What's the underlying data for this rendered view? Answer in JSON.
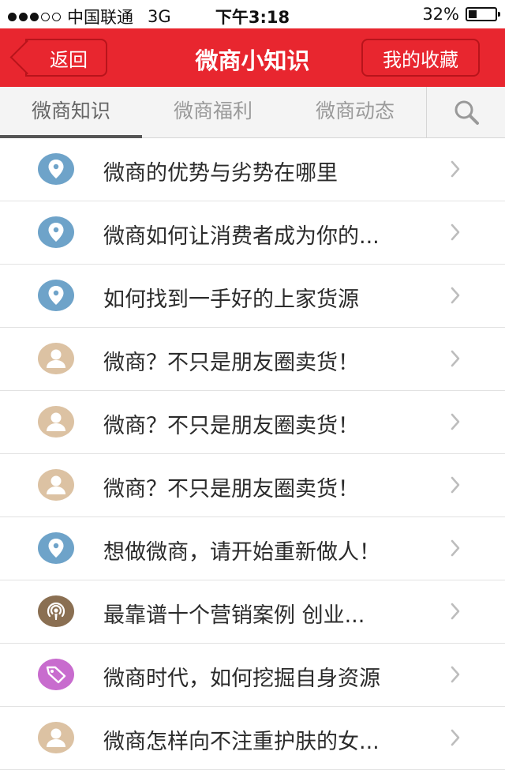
{
  "status_bar": {
    "carrier": "中国联通",
    "network": "3G",
    "time": "下午3:18",
    "battery": "32%",
    "battery_level": 0.32
  },
  "nav": {
    "back_label": "返回",
    "title": "微商小知识",
    "favorites_label": "我的收藏"
  },
  "tabs": [
    {
      "label": "微商知识",
      "active": true
    },
    {
      "label": "微商福利",
      "active": false
    },
    {
      "label": "微商动态",
      "active": false
    }
  ],
  "colors": {
    "brand_red": "#e8262f",
    "location_icon": "#6ea3c9",
    "person_icon": "#dcc2a3",
    "podcast_icon": "#8a6f52",
    "tag_icon": "#c86cce"
  },
  "items": [
    {
      "icon": "location-pin-icon",
      "title": "微商的优势与劣势在哪里"
    },
    {
      "icon": "location-pin-icon",
      "title": "微商如何让消费者成为你的..."
    },
    {
      "icon": "location-pin-icon",
      "title": "如何找到一手好的上家货源"
    },
    {
      "icon": "person-icon",
      "title": "微商？不只是朋友圈卖货！"
    },
    {
      "icon": "person-icon",
      "title": "微商？不只是朋友圈卖货！"
    },
    {
      "icon": "person-icon",
      "title": "微商？不只是朋友圈卖货！"
    },
    {
      "icon": "location-pin-icon",
      "title": "想做微商，请开始重新做人！"
    },
    {
      "icon": "podcast-icon",
      "title": "最靠谱十个营销案例 创业..."
    },
    {
      "icon": "tag-icon",
      "title": "微商时代，如何挖掘自身资源"
    },
    {
      "icon": "person-icon",
      "title": "微商怎样向不注重护肤的女..."
    }
  ]
}
